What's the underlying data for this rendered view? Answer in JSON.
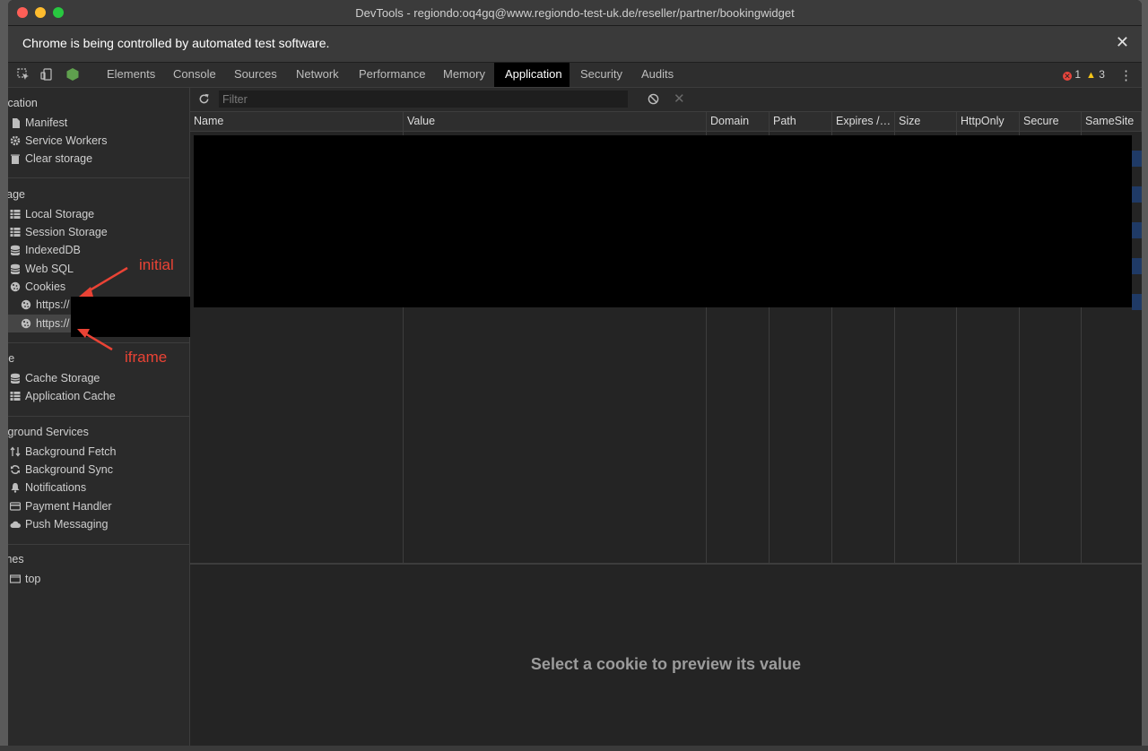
{
  "window": {
    "title": "DevTools - regiondo:oq4gq@www.regiondo-test-uk.de/reseller/partner/bookingwidget"
  },
  "infobar": {
    "message": "Chrome is being controlled by automated test software.",
    "close_glyph": "✕"
  },
  "devtools_tabs": [
    {
      "label": "Elements"
    },
    {
      "label": "Console"
    },
    {
      "label": "Sources"
    },
    {
      "label": "Network"
    },
    {
      "label": "Performance"
    },
    {
      "label": "Memory"
    },
    {
      "label": "Application",
      "active": true
    },
    {
      "label": "Security"
    },
    {
      "label": "Audits"
    }
  ],
  "status": {
    "errors": "1",
    "warnings": "3"
  },
  "sidebar": {
    "sections": {
      "application": "plication",
      "storage": "orage",
      "cache": "che",
      "background": "ckground Services",
      "frames": "ames"
    },
    "application_items": [
      {
        "label": "Manifest",
        "icon": "document-icon"
      },
      {
        "label": "Service Workers",
        "icon": "gear-icon"
      },
      {
        "label": "Clear storage",
        "icon": "trash-icon"
      }
    ],
    "storage_items": [
      {
        "label": "Local Storage",
        "icon": "grid-icon"
      },
      {
        "label": "Session Storage",
        "icon": "grid-icon"
      },
      {
        "label": "IndexedDB",
        "icon": "database-icon"
      },
      {
        "label": "Web SQL",
        "icon": "database-icon"
      },
      {
        "label": "Cookies",
        "icon": "cookie-icon"
      }
    ],
    "cookie_origins": [
      {
        "label": "https://"
      },
      {
        "label": "https://",
        "selected": true
      }
    ],
    "cache_items": [
      {
        "label": "Cache Storage",
        "icon": "database-icon"
      },
      {
        "label": "Application Cache",
        "icon": "grid-icon"
      }
    ],
    "background_items": [
      {
        "label": "Background Fetch",
        "icon": "arrows-icon"
      },
      {
        "label": "Background Sync",
        "icon": "sync-icon"
      },
      {
        "label": "Notifications",
        "icon": "bell-icon"
      },
      {
        "label": "Payment Handler",
        "icon": "card-icon"
      },
      {
        "label": "Push Messaging",
        "icon": "cloud-icon"
      }
    ],
    "frames_items": [
      {
        "label": "top",
        "icon": "frame-icon"
      }
    ]
  },
  "toolbar": {
    "filter_placeholder": "Filter"
  },
  "table": {
    "columns": [
      "Name",
      "Value",
      "Domain",
      "Path",
      "Expires /…",
      "Size",
      "HttpOnly",
      "Secure",
      "SameSite"
    ]
  },
  "preview": {
    "empty_message": "Select a cookie to preview its value"
  },
  "annotations": {
    "initial": "initial",
    "iframe": "iframe"
  },
  "colors": {
    "annotation_red": "#ea4335",
    "active_tab_bg": "#000000",
    "panel_bg": "#242424"
  }
}
